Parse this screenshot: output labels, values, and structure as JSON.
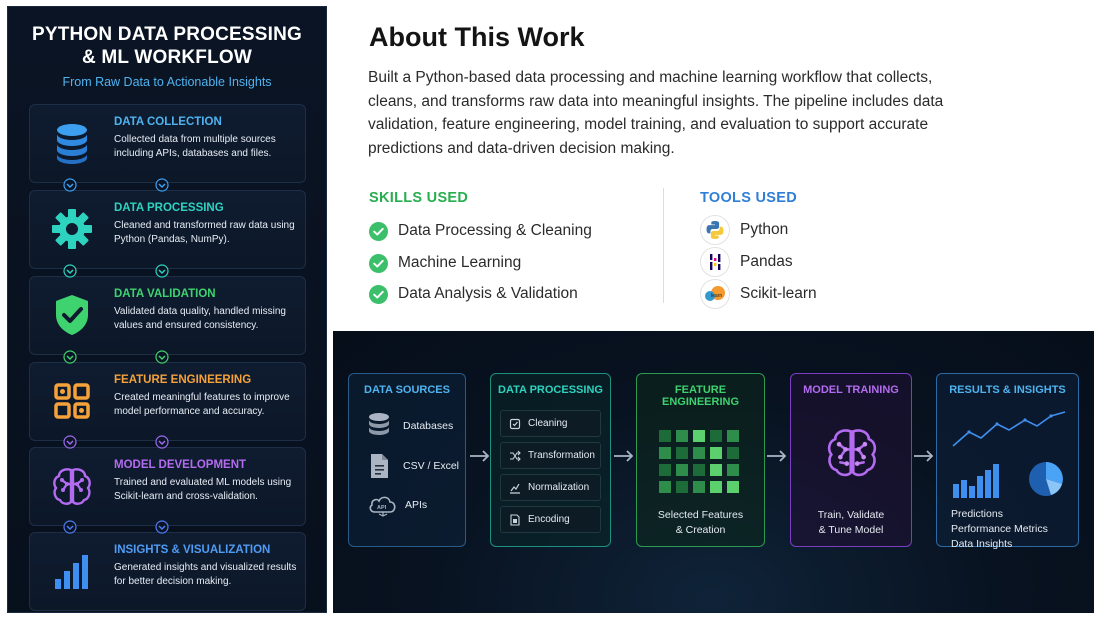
{
  "workflow": {
    "title_line1": "PYTHON DATA PROCESSING",
    "title_line2": "& ML WORKFLOW",
    "subtitle": "From Raw Data to Actionable Insights",
    "steps": [
      {
        "title": "DATA COLLECTION",
        "desc": "Collected data from multiple sources including APIs, databases and files.",
        "color": "#4fb3f0",
        "icon": "database-icon"
      },
      {
        "title": "DATA PROCESSING",
        "desc": "Cleaned and transformed raw data using Python (Pandas, NumPy).",
        "color": "#2ed3c0",
        "icon": "gear-icon"
      },
      {
        "title": "DATA VALIDATION",
        "desc": "Validated data quality, handled missing values and ensured consistency.",
        "color": "#3fd36f",
        "icon": "shield-check-icon"
      },
      {
        "title": "FEATURE ENGINEERING",
        "desc": "Created meaningful features to improve model performance and accuracy.",
        "color": "#f5a23a",
        "icon": "feature-grid-icon"
      },
      {
        "title": "MODEL DEVELOPMENT",
        "desc": "Trained and evaluated ML models using Scikit-learn and cross-validation.",
        "color": "#b36bf0",
        "icon": "brain-icon"
      },
      {
        "title": "INSIGHTS & VISUALIZATION",
        "desc": "Generated insights and visualized results for better decision making.",
        "color": "#4f9cf5",
        "icon": "bar-chart-icon"
      }
    ]
  },
  "about": {
    "title": "About This Work",
    "description": "Built a Python-based data processing and machine learning workflow that collects, cleans, and transforms raw data into meaningful insights. The pipeline includes data validation, feature engineering, model training, and evaluation to support accurate predictions and data-driven decision making.",
    "skills_heading": "SKILLS USED",
    "skills": [
      "Data Processing & Cleaning",
      "Machine Learning",
      "Data Analysis & Validation"
    ],
    "tools_heading": "TOOLS USED",
    "tools": [
      {
        "label": "Python",
        "icon": "python-logo-icon"
      },
      {
        "label": "Pandas",
        "icon": "pandas-logo-icon"
      },
      {
        "label": "Scikit-learn",
        "icon": "scikit-learn-logo-icon"
      }
    ],
    "accent_skills": "#27ae4f",
    "accent_tools": "#2f7fd6"
  },
  "pipeline": {
    "sources": {
      "heading": "DATA SOURCES",
      "items": [
        "Databases",
        "CSV / Excel",
        "APIs"
      ],
      "api_badge": "API"
    },
    "processing": {
      "heading": "DATA PROCESSING",
      "items": [
        "Cleaning",
        "Transformation",
        "Normalization",
        "Encoding"
      ]
    },
    "features": {
      "heading": "FEATURE ENGINEERING",
      "caption_line1": "Selected Features",
      "caption_line2": "& Creation"
    },
    "training": {
      "heading": "MODEL TRAINING",
      "caption_line1": "Train, Validate",
      "caption_line2": "& Tune Model"
    },
    "results": {
      "heading": "RESULTS & INSIGHTS",
      "items": [
        "Predictions",
        "Performance Metrics",
        "Data Insights"
      ]
    }
  }
}
